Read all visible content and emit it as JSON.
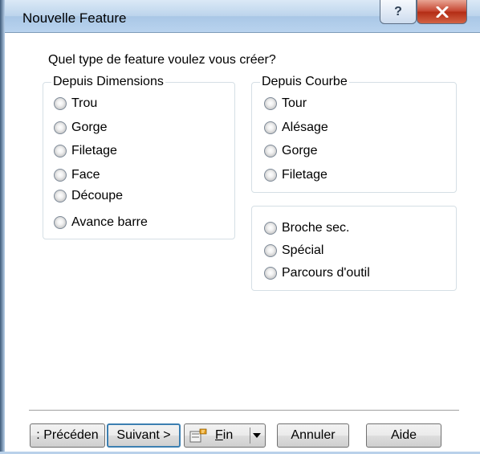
{
  "window": {
    "title": "Nouvelle Feature",
    "help_label": "?",
    "close_label": "X"
  },
  "question": "Quel type de feature voulez vous créer?",
  "groups": {
    "dimensions": {
      "title": "Depuis Dimensions",
      "options": [
        "Trou",
        "Gorge",
        "Filetage",
        "Face",
        "Découpe",
        "Avance barre"
      ]
    },
    "courbe": {
      "title": "Depuis Courbe",
      "options": [
        "Tour",
        "Alésage",
        "Gorge",
        "Filetage"
      ]
    },
    "autres": {
      "options": [
        "Broche sec.",
        "Spécial",
        "Parcours d'outil"
      ]
    }
  },
  "buttons": {
    "previous": ": Précéden",
    "next": "Suivant >",
    "finish_accel": "F",
    "finish_rest": "in",
    "cancel": "Annuler",
    "help": "Aide"
  },
  "colors": {
    "titlebar": "#bcd4ec",
    "close_button": "#c4422d",
    "default_button_border": "#3c7fb1",
    "group_border": "#d5dfe5"
  }
}
